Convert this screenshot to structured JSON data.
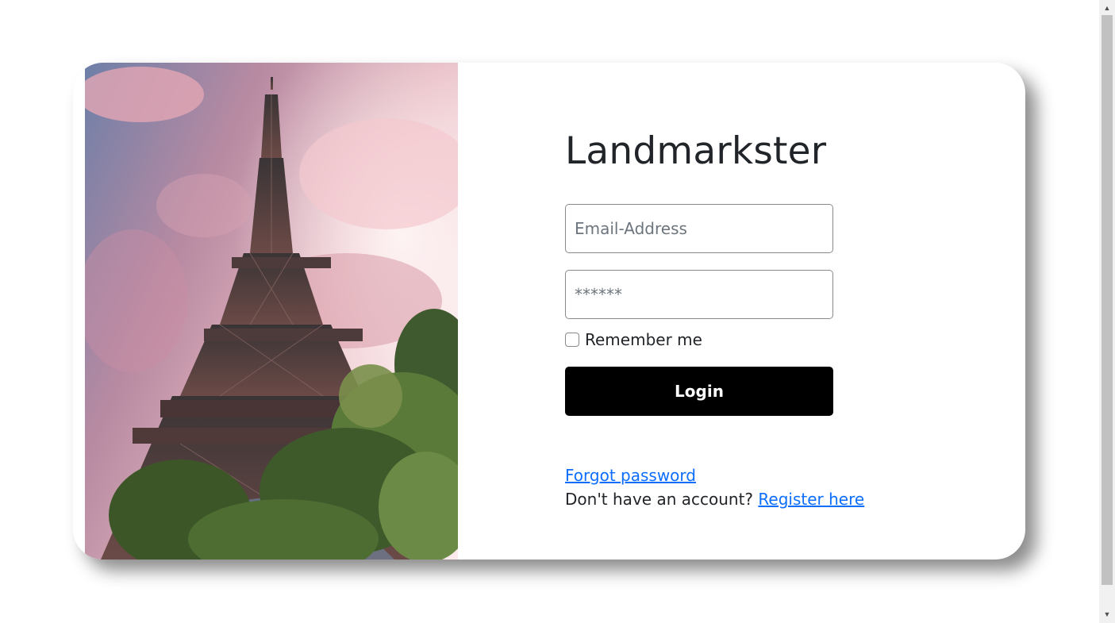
{
  "brand": {
    "title": "Landmarkster"
  },
  "form": {
    "email_placeholder": "Email-Address",
    "password_placeholder": "******",
    "remember_label": "Remember me",
    "login_label": "Login"
  },
  "links": {
    "forgot_label": "Forgot password",
    "register_prompt": "Don't have an account? ",
    "register_label": "Register here"
  },
  "image": {
    "subject": "eiffel-tower-photo"
  },
  "colors": {
    "link": "#0d6efd",
    "button": "#000000",
    "text": "#212529"
  }
}
